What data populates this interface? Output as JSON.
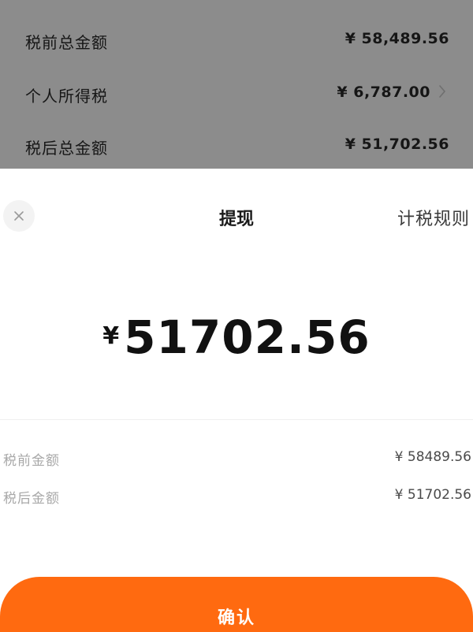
{
  "background_summary": {
    "rows": [
      {
        "label": "税前总金额",
        "amount": "¥ 58,489.56"
      },
      {
        "label": "个人所得税",
        "amount": "¥ 6,787.00"
      },
      {
        "label": "税后总金额",
        "amount": "¥ 51,702.56"
      }
    ],
    "arrow_icon": "chevron-right-icon"
  },
  "sheet": {
    "close_icon": "close-icon",
    "title": "提现",
    "tax_rules_link": "计税规则",
    "currency_symbol": "¥",
    "amount": "51702.56",
    "details": [
      {
        "label": "税前金额",
        "amount": "¥ 58489.56"
      },
      {
        "label": "税后金额",
        "amount": "¥ 51702.56"
      }
    ],
    "confirm_label": "确认"
  },
  "colors": {
    "overlay": "#8c8c8c",
    "accent": "#ff6a10",
    "muted_text": "#a8a8a8"
  }
}
